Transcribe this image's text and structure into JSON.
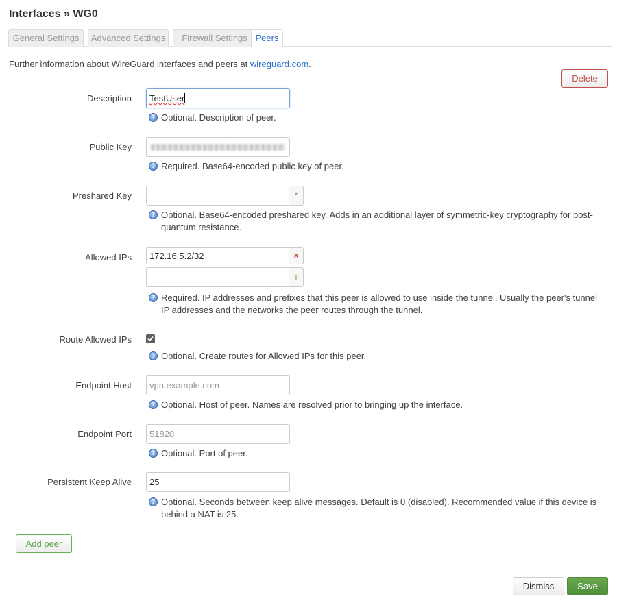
{
  "page": {
    "title": "Interfaces » WG0",
    "tabs": [
      {
        "label": "General Settings",
        "active": false
      },
      {
        "label": "Advanced Settings",
        "active": false
      },
      {
        "label": "Firewall Settings",
        "active": false
      },
      {
        "label": "Peers",
        "active": true
      }
    ],
    "info_text": "Further information about WireGuard interfaces and peers at ",
    "info_link": "wireguard.com",
    "info_suffix": "."
  },
  "buttons": {
    "delete": "Delete",
    "add_peer": "Add peer",
    "dismiss": "Dismiss",
    "save": "Save"
  },
  "fields": {
    "description": {
      "label": "Description",
      "value": "TestUser",
      "help": "Optional. Description of peer."
    },
    "public_key": {
      "label": "Public Key",
      "value": "(redacted)",
      "help": "Required. Base64-encoded public key of peer."
    },
    "preshared_key": {
      "label": "Preshared Key",
      "value": "",
      "reveal_glyph": "*",
      "help": "Optional. Base64-encoded preshared key. Adds in an additional layer of symmetric-key cryptography for post-quantum resistance."
    },
    "allowed_ips": {
      "label": "Allowed IPs",
      "values": [
        "172.16.5.2/32"
      ],
      "new_value": "",
      "remove_glyph": "×",
      "add_glyph": "+",
      "help": "Required. IP addresses and prefixes that this peer is allowed to use inside the tunnel. Usually the peer's tunnel IP addresses and the networks the peer routes through the tunnel."
    },
    "route_allowed_ips": {
      "label": "Route Allowed IPs",
      "checked": true,
      "help": "Optional. Create routes for Allowed IPs for this peer."
    },
    "endpoint_host": {
      "label": "Endpoint Host",
      "placeholder": "vpn.example.com",
      "value": "",
      "help": "Optional. Host of peer. Names are resolved prior to bringing up the interface."
    },
    "endpoint_port": {
      "label": "Endpoint Port",
      "placeholder": "51820",
      "value": "",
      "help": "Optional. Port of peer."
    },
    "persistent_keepalive": {
      "label": "Persistent Keep Alive",
      "value": "25",
      "help": "Optional. Seconds between keep alive messages. Default is 0 (disabled). Recommended value if this device is behind a NAT is 25."
    }
  },
  "icons": {
    "help": "?"
  },
  "colors": {
    "link": "#2a6eca",
    "delete": "#c0504d",
    "add": "#5aa24a",
    "save": "#5a9a45"
  }
}
